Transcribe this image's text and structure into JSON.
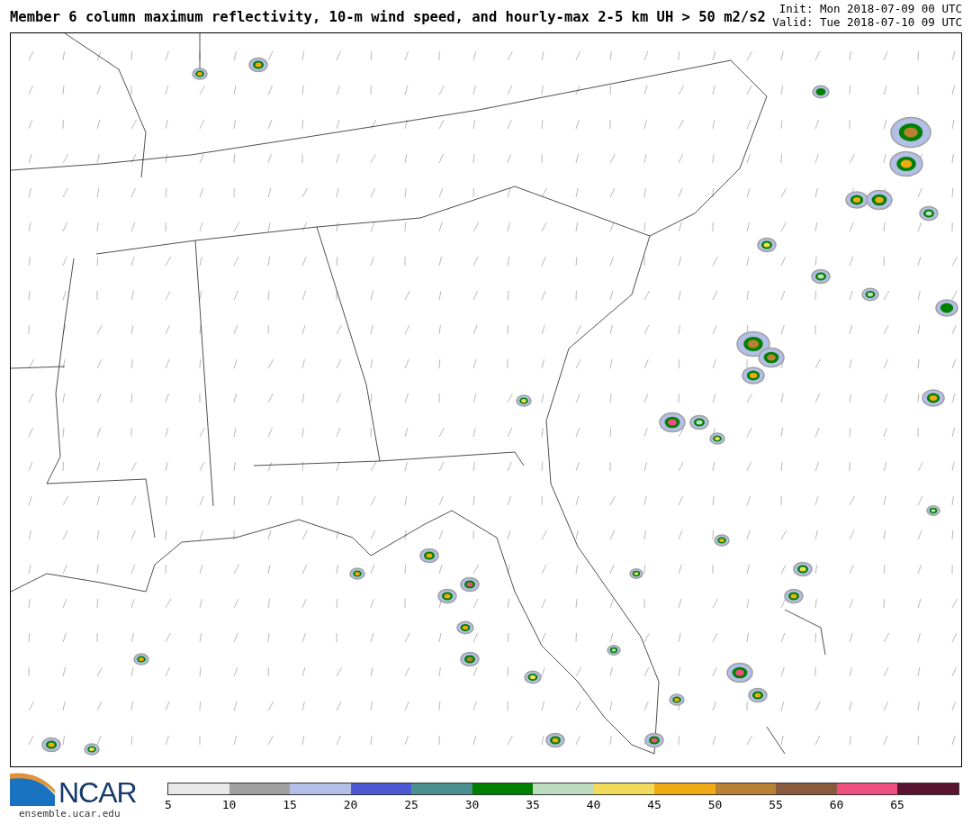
{
  "header": {
    "title": "Member 6 column maximum reflectivity, 10-m wind speed, and hourly-max 2-5 km UH > 50 m2/s2",
    "init": "Init: Mon 2018-07-09 00 UTC",
    "valid": "Valid: Tue 2018-07-10 09 UTC"
  },
  "footer": {
    "logo_text": "NCAR",
    "url": "ensemble.ucar.edu"
  },
  "colorbar": {
    "segments": [
      {
        "label": "5",
        "color": "#e8e8e8"
      },
      {
        "label": "10",
        "color": "#a0a0a0"
      },
      {
        "label": "15",
        "color": "#b3bfe8"
      },
      {
        "label": "20",
        "color": "#4c58d4"
      },
      {
        "label": "25",
        "color": "#4a9090"
      },
      {
        "label": "30",
        "color": "#008000"
      },
      {
        "label": "35",
        "color": "#bddbbd"
      },
      {
        "label": "40",
        "color": "#f0dc5a"
      },
      {
        "label": "45",
        "color": "#f0aa14"
      },
      {
        "label": "50",
        "color": "#b98232"
      },
      {
        "label": "55",
        "color": "#8a5a3c"
      },
      {
        "label": "60",
        "color": "#f05080"
      },
      {
        "label": "65",
        "color": "#5a1432"
      }
    ]
  }
}
